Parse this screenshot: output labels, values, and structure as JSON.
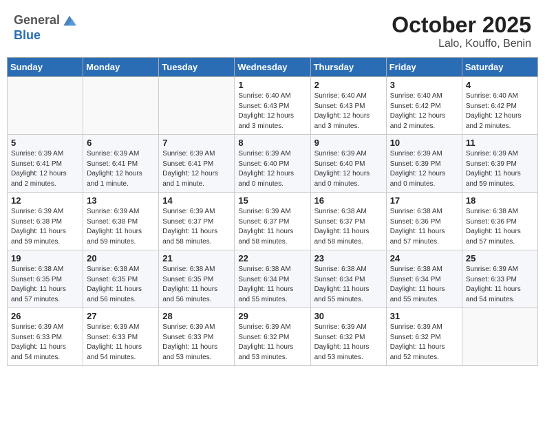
{
  "header": {
    "logo_general": "General",
    "logo_blue": "Blue",
    "month": "October 2025",
    "location": "Lalo, Kouffo, Benin"
  },
  "weekdays": [
    "Sunday",
    "Monday",
    "Tuesday",
    "Wednesday",
    "Thursday",
    "Friday",
    "Saturday"
  ],
  "weeks": [
    [
      {
        "day": "",
        "info": ""
      },
      {
        "day": "",
        "info": ""
      },
      {
        "day": "",
        "info": ""
      },
      {
        "day": "1",
        "info": "Sunrise: 6:40 AM\nSunset: 6:43 PM\nDaylight: 12 hours\nand 3 minutes."
      },
      {
        "day": "2",
        "info": "Sunrise: 6:40 AM\nSunset: 6:43 PM\nDaylight: 12 hours\nand 3 minutes."
      },
      {
        "day": "3",
        "info": "Sunrise: 6:40 AM\nSunset: 6:42 PM\nDaylight: 12 hours\nand 2 minutes."
      },
      {
        "day": "4",
        "info": "Sunrise: 6:40 AM\nSunset: 6:42 PM\nDaylight: 12 hours\nand 2 minutes."
      }
    ],
    [
      {
        "day": "5",
        "info": "Sunrise: 6:39 AM\nSunset: 6:41 PM\nDaylight: 12 hours\nand 2 minutes."
      },
      {
        "day": "6",
        "info": "Sunrise: 6:39 AM\nSunset: 6:41 PM\nDaylight: 12 hours\nand 1 minute."
      },
      {
        "day": "7",
        "info": "Sunrise: 6:39 AM\nSunset: 6:41 PM\nDaylight: 12 hours\nand 1 minute."
      },
      {
        "day": "8",
        "info": "Sunrise: 6:39 AM\nSunset: 6:40 PM\nDaylight: 12 hours\nand 0 minutes."
      },
      {
        "day": "9",
        "info": "Sunrise: 6:39 AM\nSunset: 6:40 PM\nDaylight: 12 hours\nand 0 minutes."
      },
      {
        "day": "10",
        "info": "Sunrise: 6:39 AM\nSunset: 6:39 PM\nDaylight: 12 hours\nand 0 minutes."
      },
      {
        "day": "11",
        "info": "Sunrise: 6:39 AM\nSunset: 6:39 PM\nDaylight: 11 hours\nand 59 minutes."
      }
    ],
    [
      {
        "day": "12",
        "info": "Sunrise: 6:39 AM\nSunset: 6:38 PM\nDaylight: 11 hours\nand 59 minutes."
      },
      {
        "day": "13",
        "info": "Sunrise: 6:39 AM\nSunset: 6:38 PM\nDaylight: 11 hours\nand 59 minutes."
      },
      {
        "day": "14",
        "info": "Sunrise: 6:39 AM\nSunset: 6:37 PM\nDaylight: 11 hours\nand 58 minutes."
      },
      {
        "day": "15",
        "info": "Sunrise: 6:39 AM\nSunset: 6:37 PM\nDaylight: 11 hours\nand 58 minutes."
      },
      {
        "day": "16",
        "info": "Sunrise: 6:38 AM\nSunset: 6:37 PM\nDaylight: 11 hours\nand 58 minutes."
      },
      {
        "day": "17",
        "info": "Sunrise: 6:38 AM\nSunset: 6:36 PM\nDaylight: 11 hours\nand 57 minutes."
      },
      {
        "day": "18",
        "info": "Sunrise: 6:38 AM\nSunset: 6:36 PM\nDaylight: 11 hours\nand 57 minutes."
      }
    ],
    [
      {
        "day": "19",
        "info": "Sunrise: 6:38 AM\nSunset: 6:35 PM\nDaylight: 11 hours\nand 57 minutes."
      },
      {
        "day": "20",
        "info": "Sunrise: 6:38 AM\nSunset: 6:35 PM\nDaylight: 11 hours\nand 56 minutes."
      },
      {
        "day": "21",
        "info": "Sunrise: 6:38 AM\nSunset: 6:35 PM\nDaylight: 11 hours\nand 56 minutes."
      },
      {
        "day": "22",
        "info": "Sunrise: 6:38 AM\nSunset: 6:34 PM\nDaylight: 11 hours\nand 55 minutes."
      },
      {
        "day": "23",
        "info": "Sunrise: 6:38 AM\nSunset: 6:34 PM\nDaylight: 11 hours\nand 55 minutes."
      },
      {
        "day": "24",
        "info": "Sunrise: 6:38 AM\nSunset: 6:34 PM\nDaylight: 11 hours\nand 55 minutes."
      },
      {
        "day": "25",
        "info": "Sunrise: 6:39 AM\nSunset: 6:33 PM\nDaylight: 11 hours\nand 54 minutes."
      }
    ],
    [
      {
        "day": "26",
        "info": "Sunrise: 6:39 AM\nSunset: 6:33 PM\nDaylight: 11 hours\nand 54 minutes."
      },
      {
        "day": "27",
        "info": "Sunrise: 6:39 AM\nSunset: 6:33 PM\nDaylight: 11 hours\nand 54 minutes."
      },
      {
        "day": "28",
        "info": "Sunrise: 6:39 AM\nSunset: 6:33 PM\nDaylight: 11 hours\nand 53 minutes."
      },
      {
        "day": "29",
        "info": "Sunrise: 6:39 AM\nSunset: 6:32 PM\nDaylight: 11 hours\nand 53 minutes."
      },
      {
        "day": "30",
        "info": "Sunrise: 6:39 AM\nSunset: 6:32 PM\nDaylight: 11 hours\nand 53 minutes."
      },
      {
        "day": "31",
        "info": "Sunrise: 6:39 AM\nSunset: 6:32 PM\nDaylight: 11 hours\nand 52 minutes."
      },
      {
        "day": "",
        "info": ""
      }
    ]
  ]
}
